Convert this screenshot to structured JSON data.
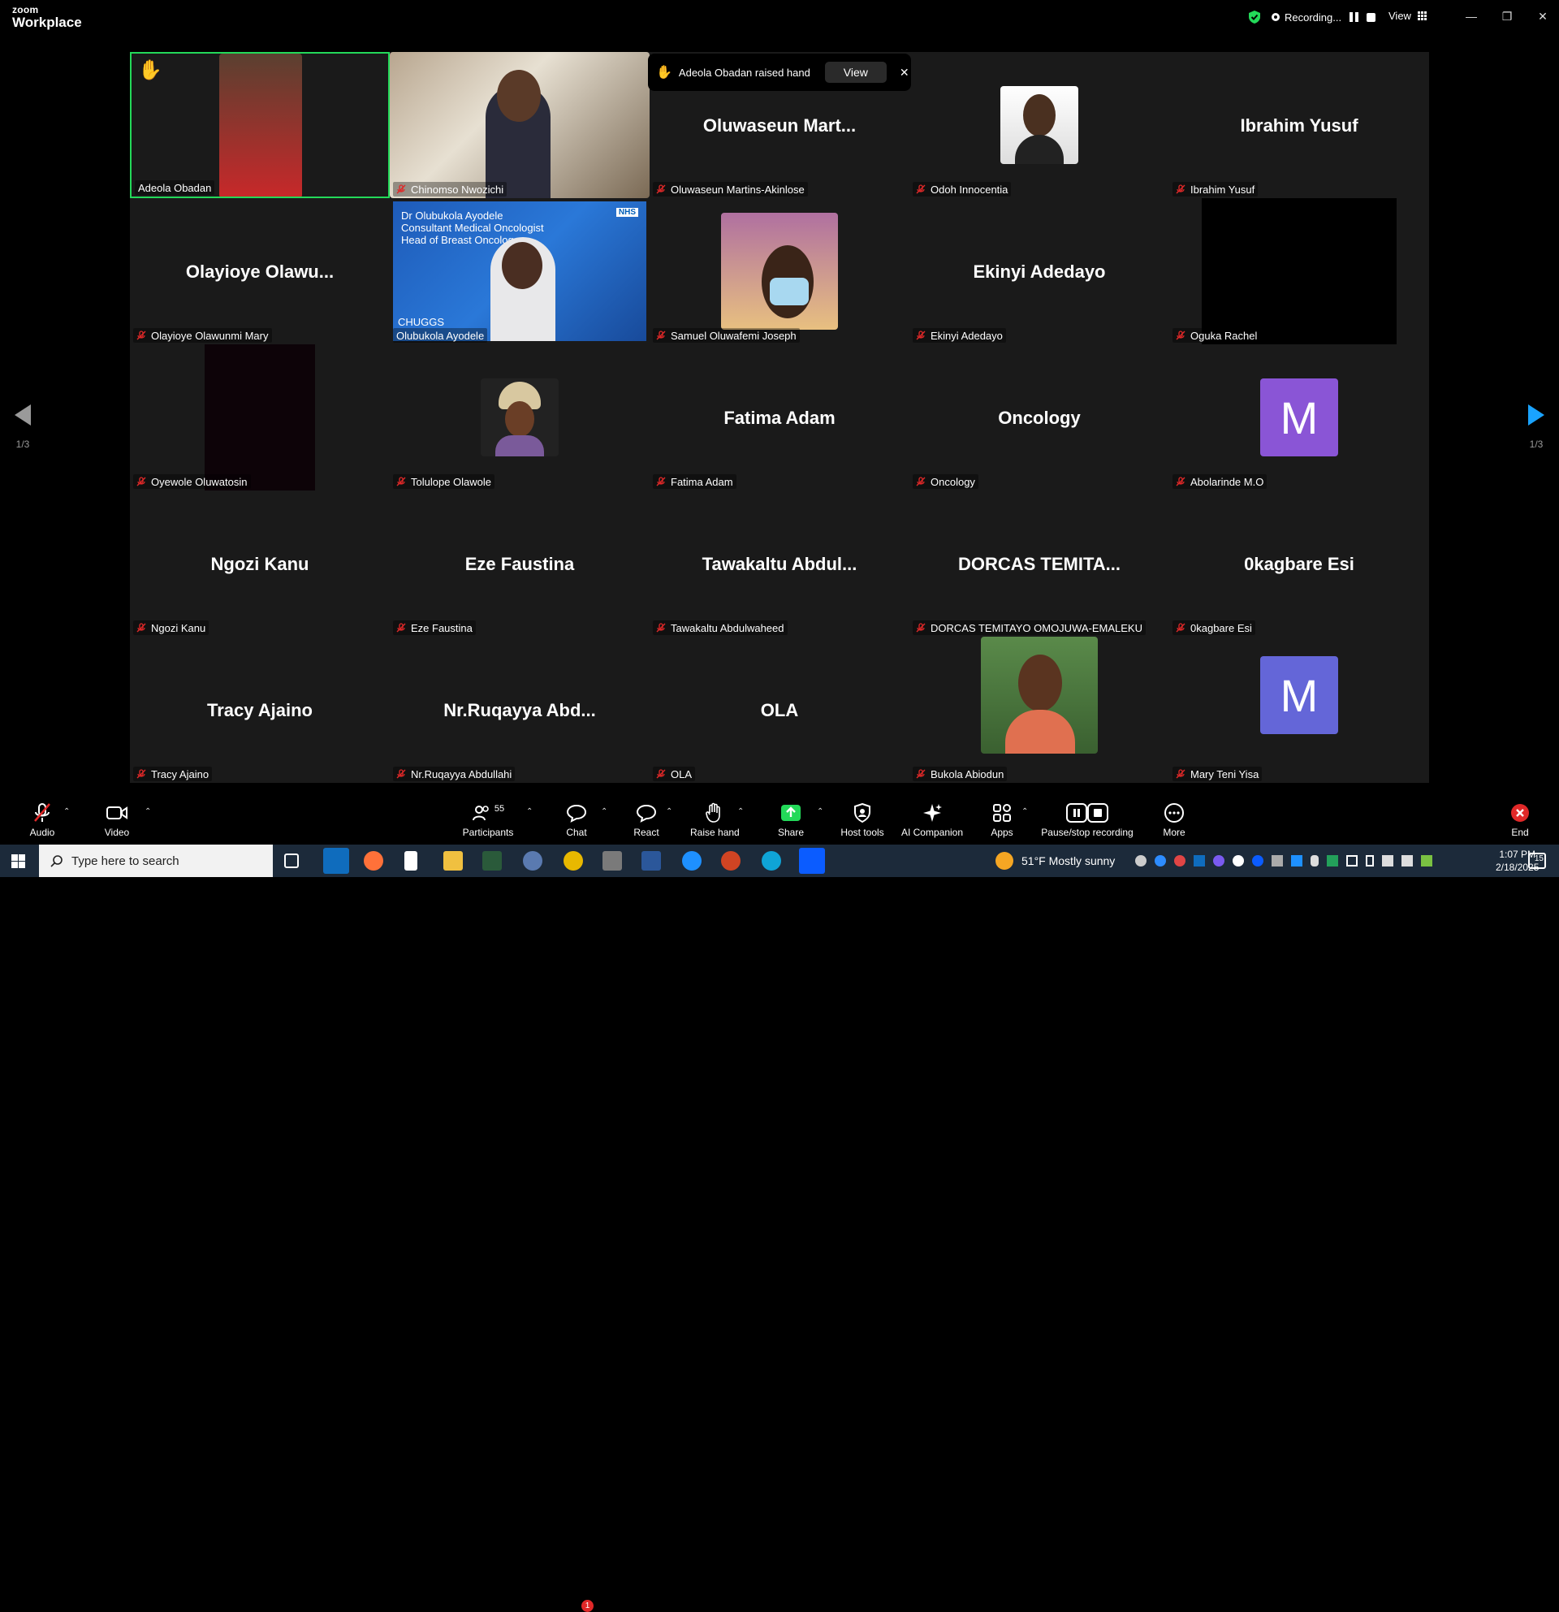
{
  "app": {
    "logo_top": "zoom",
    "logo_bottom": "Workplace"
  },
  "titlebar": {
    "recording_label": "Recording...",
    "view_label": "View",
    "minimize": "—",
    "restore": "❐",
    "close": "✕"
  },
  "toast": {
    "text": "Adeola Obadan raised hand",
    "view_button": "View",
    "close": "✕"
  },
  "pagination": {
    "left": "1/3",
    "right": "1/3"
  },
  "tiles": [
    {
      "label": "Adeola Obadan",
      "big": "",
      "muted": false,
      "hand": true
    },
    {
      "label": "Chinomso Nwozichi",
      "big": "",
      "muted": true
    },
    {
      "label": "Oluwaseun Martins-Akinlose",
      "big": "Oluwaseun Mart...",
      "muted": true
    },
    {
      "label": "Odoh Innocentia",
      "big": "",
      "muted": true
    },
    {
      "label": "Ibrahim Yusuf",
      "big": "Ibrahim Yusuf",
      "muted": true
    },
    {
      "label": "Olayioye Olawunmi Mary",
      "big": "Olayioye Olawu...",
      "muted": true
    },
    {
      "label": "Olubukola Ayodele",
      "big": "",
      "muted": false
    },
    {
      "label": "Samuel Oluwafemi Joseph",
      "big": "",
      "muted": true
    },
    {
      "label": "Ekinyi Adedayo",
      "big": "Ekinyi Adedayo",
      "muted": true
    },
    {
      "label": "Oguka Rachel",
      "big": "",
      "muted": true
    },
    {
      "label": "Oyewole Oluwatosin",
      "big": "",
      "muted": true
    },
    {
      "label": "Tolulope Olawole",
      "big": "",
      "muted": true
    },
    {
      "label": "Fatima Adam",
      "big": "Fatima Adam",
      "muted": true
    },
    {
      "label": "Oncology",
      "big": "Oncology",
      "muted": true
    },
    {
      "label": "Abolarinde M.O",
      "big": "",
      "muted": true
    },
    {
      "label": "Ngozi Kanu",
      "big": "Ngozi Kanu",
      "muted": true
    },
    {
      "label": "Eze Faustina",
      "big": "Eze Faustina",
      "muted": true
    },
    {
      "label": "Tawakaltu Abdulwaheed",
      "big": "Tawakaltu Abdul...",
      "muted": true
    },
    {
      "label": "DORCAS TEMITAYO OMOJUWA-EMALEKU",
      "big": "DORCAS TEMITA...",
      "muted": true
    },
    {
      "label": "0kagbare Esi",
      "big": "0kagbare Esi",
      "muted": true
    },
    {
      "label": "Tracy Ajaino",
      "big": "Tracy Ajaino",
      "muted": true
    },
    {
      "label": "Nr.Ruqayya Abdullahi",
      "big": "Nr.Ruqayya Abd...",
      "muted": true
    },
    {
      "label": "OLA",
      "big": "OLA",
      "muted": true
    },
    {
      "label": "Bukola Abiodun",
      "big": "",
      "muted": true
    },
    {
      "label": "Mary Teni Yisa",
      "big": "",
      "muted": true
    }
  ],
  "slide": {
    "line1": "Dr Olubukola Ayodele",
    "line2": "Consultant Medical Oncologist",
    "line3": "Head of Breast Oncolog",
    "brand": "NHS",
    "footer": "CHUGGS"
  },
  "avatars": {
    "abolarinde": "M",
    "mary": "M"
  },
  "toolbar": {
    "audio": "Audio",
    "video": "Video",
    "participants": "Participants",
    "participants_count": "55",
    "chat": "Chat",
    "chat_badge": "1",
    "react": "React",
    "raise_hand": "Raise hand",
    "share": "Share",
    "host_tools": "Host tools",
    "ai_companion": "AI Companion",
    "apps": "Apps",
    "pause_stop": "Pause/stop recording",
    "more": "More",
    "end": "End"
  },
  "taskbar": {
    "search_placeholder": "Type here to search",
    "weather": "51°F  Mostly sunny",
    "time": "1:07 PM",
    "date": "2/18/2025",
    "notifications": "15"
  }
}
